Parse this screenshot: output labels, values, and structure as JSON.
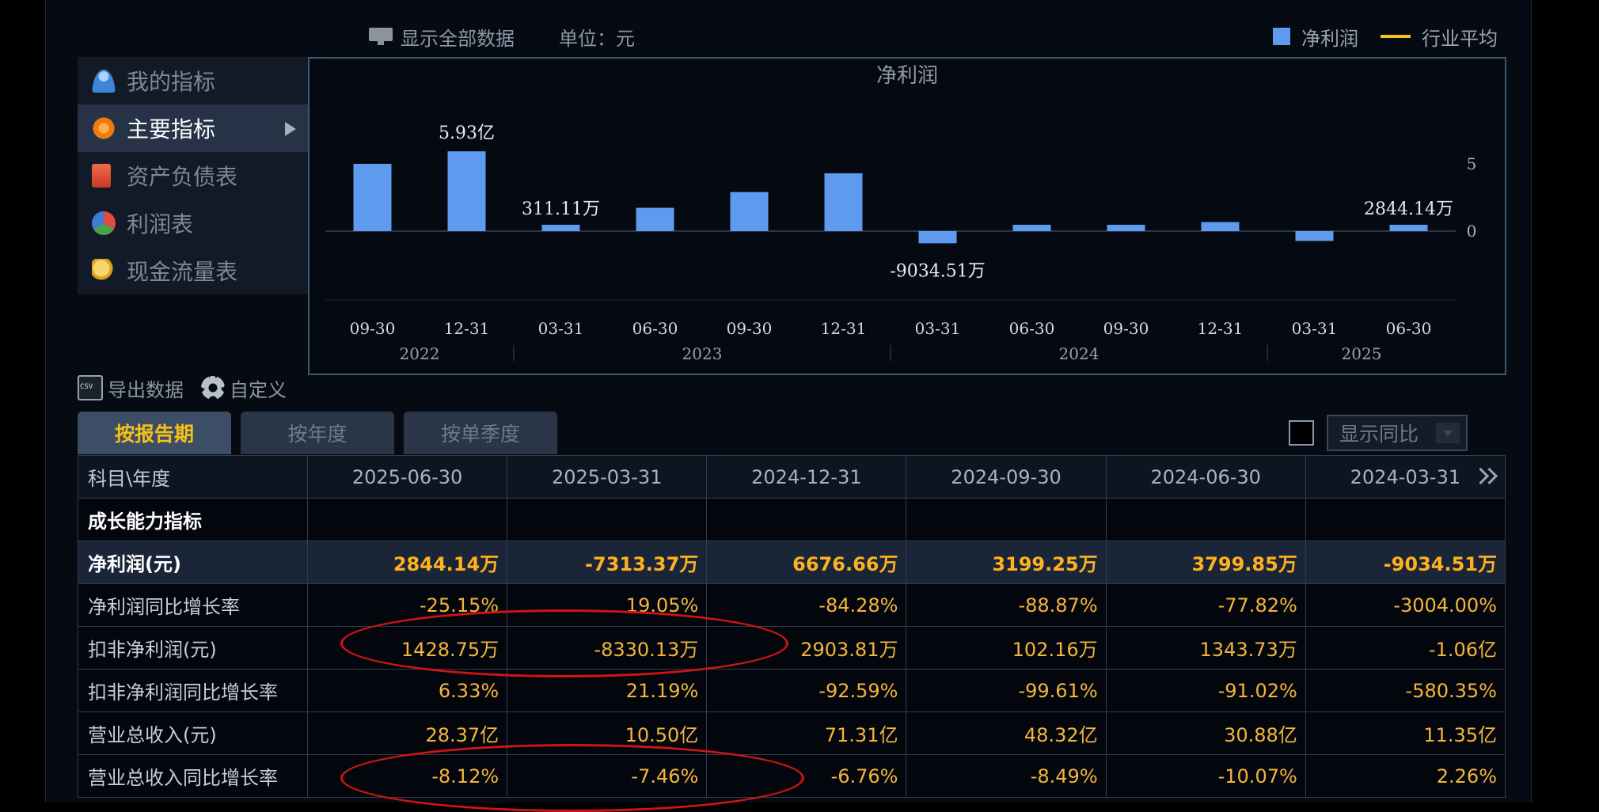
{
  "toolbar": {
    "show_all_label": "显示全部数据",
    "unit_label": "单位：元"
  },
  "legend": {
    "bar_label": "净利润",
    "line_label": "行业平均"
  },
  "menu": {
    "items": [
      {
        "label": "我的指标",
        "icon": "user-icon"
      },
      {
        "label": "主要指标",
        "icon": "star-icon",
        "active": true
      },
      {
        "label": "资产负债表",
        "icon": "book-icon"
      },
      {
        "label": "利润表",
        "icon": "pie-chart-icon"
      },
      {
        "label": "现金流量表",
        "icon": "coins-icon"
      }
    ]
  },
  "chart_data": {
    "type": "bar",
    "title": "净利润",
    "categories": [
      "09-30",
      "12-31",
      "03-31",
      "06-30",
      "09-30",
      "12-31",
      "03-31",
      "06-30",
      "09-30",
      "12-31",
      "03-31",
      "06-30"
    ],
    "years": [
      {
        "label": "2022",
        "from": 0,
        "to": 1
      },
      {
        "label": "2023",
        "from": 2,
        "to": 5
      },
      {
        "label": "2024",
        "from": 6,
        "to": 9
      },
      {
        "label": "2025",
        "from": 10,
        "to": 11
      }
    ],
    "series": [
      {
        "values": [
          5.0,
          5.93,
          0.0311,
          1.73,
          2.9,
          4.3,
          -0.9035,
          0.38,
          0.32,
          0.67,
          -0.7313,
          0.2844
        ]
      }
    ],
    "data_labels": [
      {
        "index": 1,
        "text": "5.93亿"
      },
      {
        "index": 2,
        "text": "311.11万"
      },
      {
        "index": 6,
        "text": "-9034.51万"
      },
      {
        "index": 11,
        "text": "2844.14万"
      }
    ],
    "ylim": [
      -5,
      10
    ],
    "yticks": [
      0,
      5
    ],
    "bar_color": "#5e9bef"
  },
  "tools": {
    "export_label": "导出数据",
    "custom_label": "自定义"
  },
  "tabs": [
    {
      "label": "按报告期",
      "active": true
    },
    {
      "label": "按年度"
    },
    {
      "label": "按单季度"
    }
  ],
  "yoy_select": {
    "value": "显示同比"
  },
  "table": {
    "header_first": "科目\\年度",
    "columns": [
      "2025-06-30",
      "2025-03-31",
      "2024-12-31",
      "2024-09-30",
      "2024-06-30",
      "2024-03-31"
    ],
    "rows": [
      {
        "label": "成长能力指标",
        "values": [
          "",
          "",
          "",
          "",
          "",
          ""
        ],
        "kind": "section"
      },
      {
        "label": "净利润(元)",
        "values": [
          "2844.14万",
          "-7313.37万",
          "6676.66万",
          "3199.25万",
          "3799.85万",
          "-9034.51万"
        ],
        "kind": "hl"
      },
      {
        "label": "净利润同比增长率",
        "values": [
          "-25.15%",
          "19.05%",
          "-84.28%",
          "-88.87%",
          "-77.82%",
          "-3004.00%"
        ]
      },
      {
        "label": "扣非净利润(元)",
        "values": [
          "1428.75万",
          "-8330.13万",
          "2903.81万",
          "102.16万",
          "1343.73万",
          "-1.06亿"
        ]
      },
      {
        "label": "扣非净利润同比增长率",
        "values": [
          "6.33%",
          "21.19%",
          "-92.59%",
          "-99.61%",
          "-91.02%",
          "-580.35%"
        ]
      },
      {
        "label": "营业总收入(元)",
        "values": [
          "28.37亿",
          "10.50亿",
          "71.31亿",
          "48.32亿",
          "30.88亿",
          "11.35亿"
        ]
      },
      {
        "label": "营业总收入同比增长率",
        "values": [
          "-8.12%",
          "-7.46%",
          "-6.76%",
          "-8.49%",
          "-10.07%",
          "2.26%"
        ]
      }
    ]
  }
}
